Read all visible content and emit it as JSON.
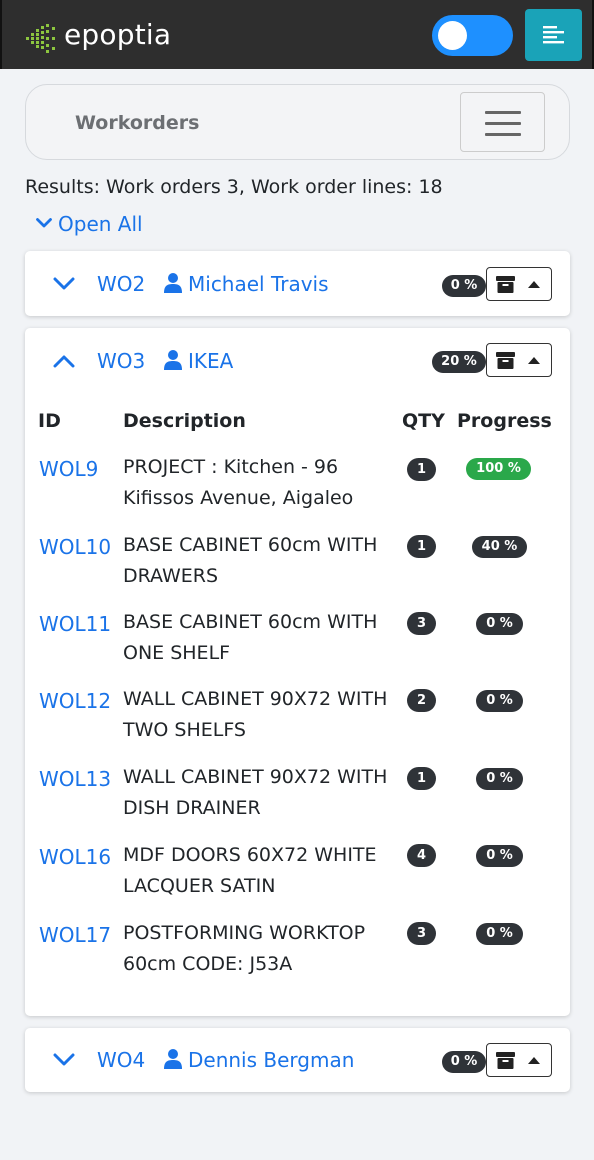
{
  "app": {
    "brand": "epoptia"
  },
  "header": {
    "toggle_on": true
  },
  "subnav": {
    "title": "Workorders"
  },
  "summary": {
    "results": "Results: Work orders 3, Work order lines: 18",
    "open_all": "Open All"
  },
  "colors": {
    "accent": "#1a73e8",
    "navbar": "#2e2e2e",
    "menu_button": "#1aa3b8",
    "toggle": "#1e90ff",
    "badge": "#2f3338",
    "complete": "#2aa84a"
  },
  "icons": {
    "expand": "chevron-down-icon",
    "collapse": "chevron-up-icon",
    "customer": "user-icon",
    "archive": "archive-icon",
    "menu": "menu-icon"
  },
  "workorders": [
    {
      "id": "WO2",
      "customer": "Michael Travis",
      "progress": "0 %",
      "expanded": false
    },
    {
      "id": "WO3",
      "customer": "IKEA",
      "progress": "20 %",
      "expanded": true
    },
    {
      "id": "WO4",
      "customer": "Dennis Bergman",
      "progress": "0 %",
      "expanded": false
    }
  ],
  "lines_table": {
    "headers": {
      "id": "ID",
      "description": "Description",
      "qty": "QTY",
      "progress": "Progress"
    },
    "rows": [
      {
        "id": "WOL9",
        "description": "PROJECT : Kitchen - 96 Kifissos Avenue, Aigaleo",
        "qty": "1",
        "progress": "100 %",
        "complete": true
      },
      {
        "id": "WOL10",
        "description": "BASE CABINET 60cm WITH DRAWERS",
        "qty": "1",
        "progress": "40 %"
      },
      {
        "id": "WOL11",
        "description": "BASE CABINET 60cm WITH ONE SHELF",
        "qty": "3",
        "progress": "0 %"
      },
      {
        "id": "WOL12",
        "description": "WALL CABINET 90X72 WITH TWO SHELFS",
        "qty": "2",
        "progress": "0 %"
      },
      {
        "id": "WOL13",
        "description": "WALL CABINET 90X72 WITH DISH DRAINER",
        "qty": "1",
        "progress": "0 %"
      },
      {
        "id": "WOL16",
        "description": "MDF DOORS 60X72 WHITE LACQUER SATIN",
        "qty": "4",
        "progress": "0 %"
      },
      {
        "id": "WOL17",
        "description": "POSTFORMING WORKTOP 60cm CODE: J53A",
        "qty": "3",
        "progress": "0 %"
      }
    ]
  }
}
